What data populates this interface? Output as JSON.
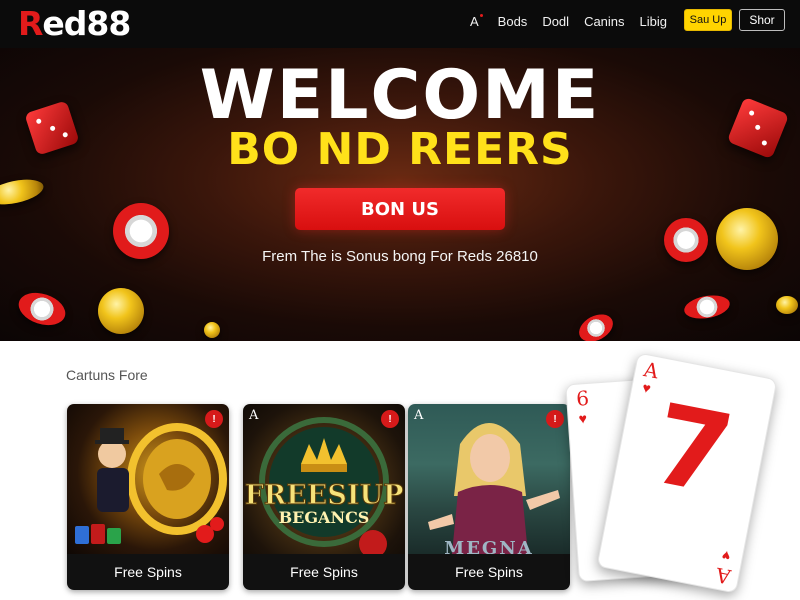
{
  "nav": {
    "logo_red": "R",
    "logo_white": "ed88",
    "links": [
      "A",
      "Bods",
      "Dodl",
      "Canins",
      "Libig"
    ],
    "signup_label": "Sau Up",
    "show_label": "Shor"
  },
  "hero": {
    "title": "WELCOME",
    "subtitle": "BO ND REERS",
    "cta_label": "BON US",
    "note": "Frem The is Sonus bong For Reds 26810"
  },
  "games": {
    "section_title": "Cartuns Fore",
    "cards": [
      {
        "footer": "Free Spins",
        "badge": "!",
        "corner": "",
        "banner": ""
      },
      {
        "footer": "Free Spins",
        "badge": "!",
        "corner": "A",
        "banner_top": "FREESIUP",
        "banner_bottom": "BEGANCS"
      },
      {
        "footer": "Free Spins",
        "badge": "!",
        "corner": "A",
        "banner_bottom": "MEGNA"
      }
    ]
  },
  "playing_cards": {
    "back_rank": "6",
    "front_rank": "A",
    "front_big": "7"
  },
  "colors": {
    "brand_red": "#e21b1b",
    "accent_yellow": "#ffd400",
    "nav_bg": "#0b0b0b"
  }
}
